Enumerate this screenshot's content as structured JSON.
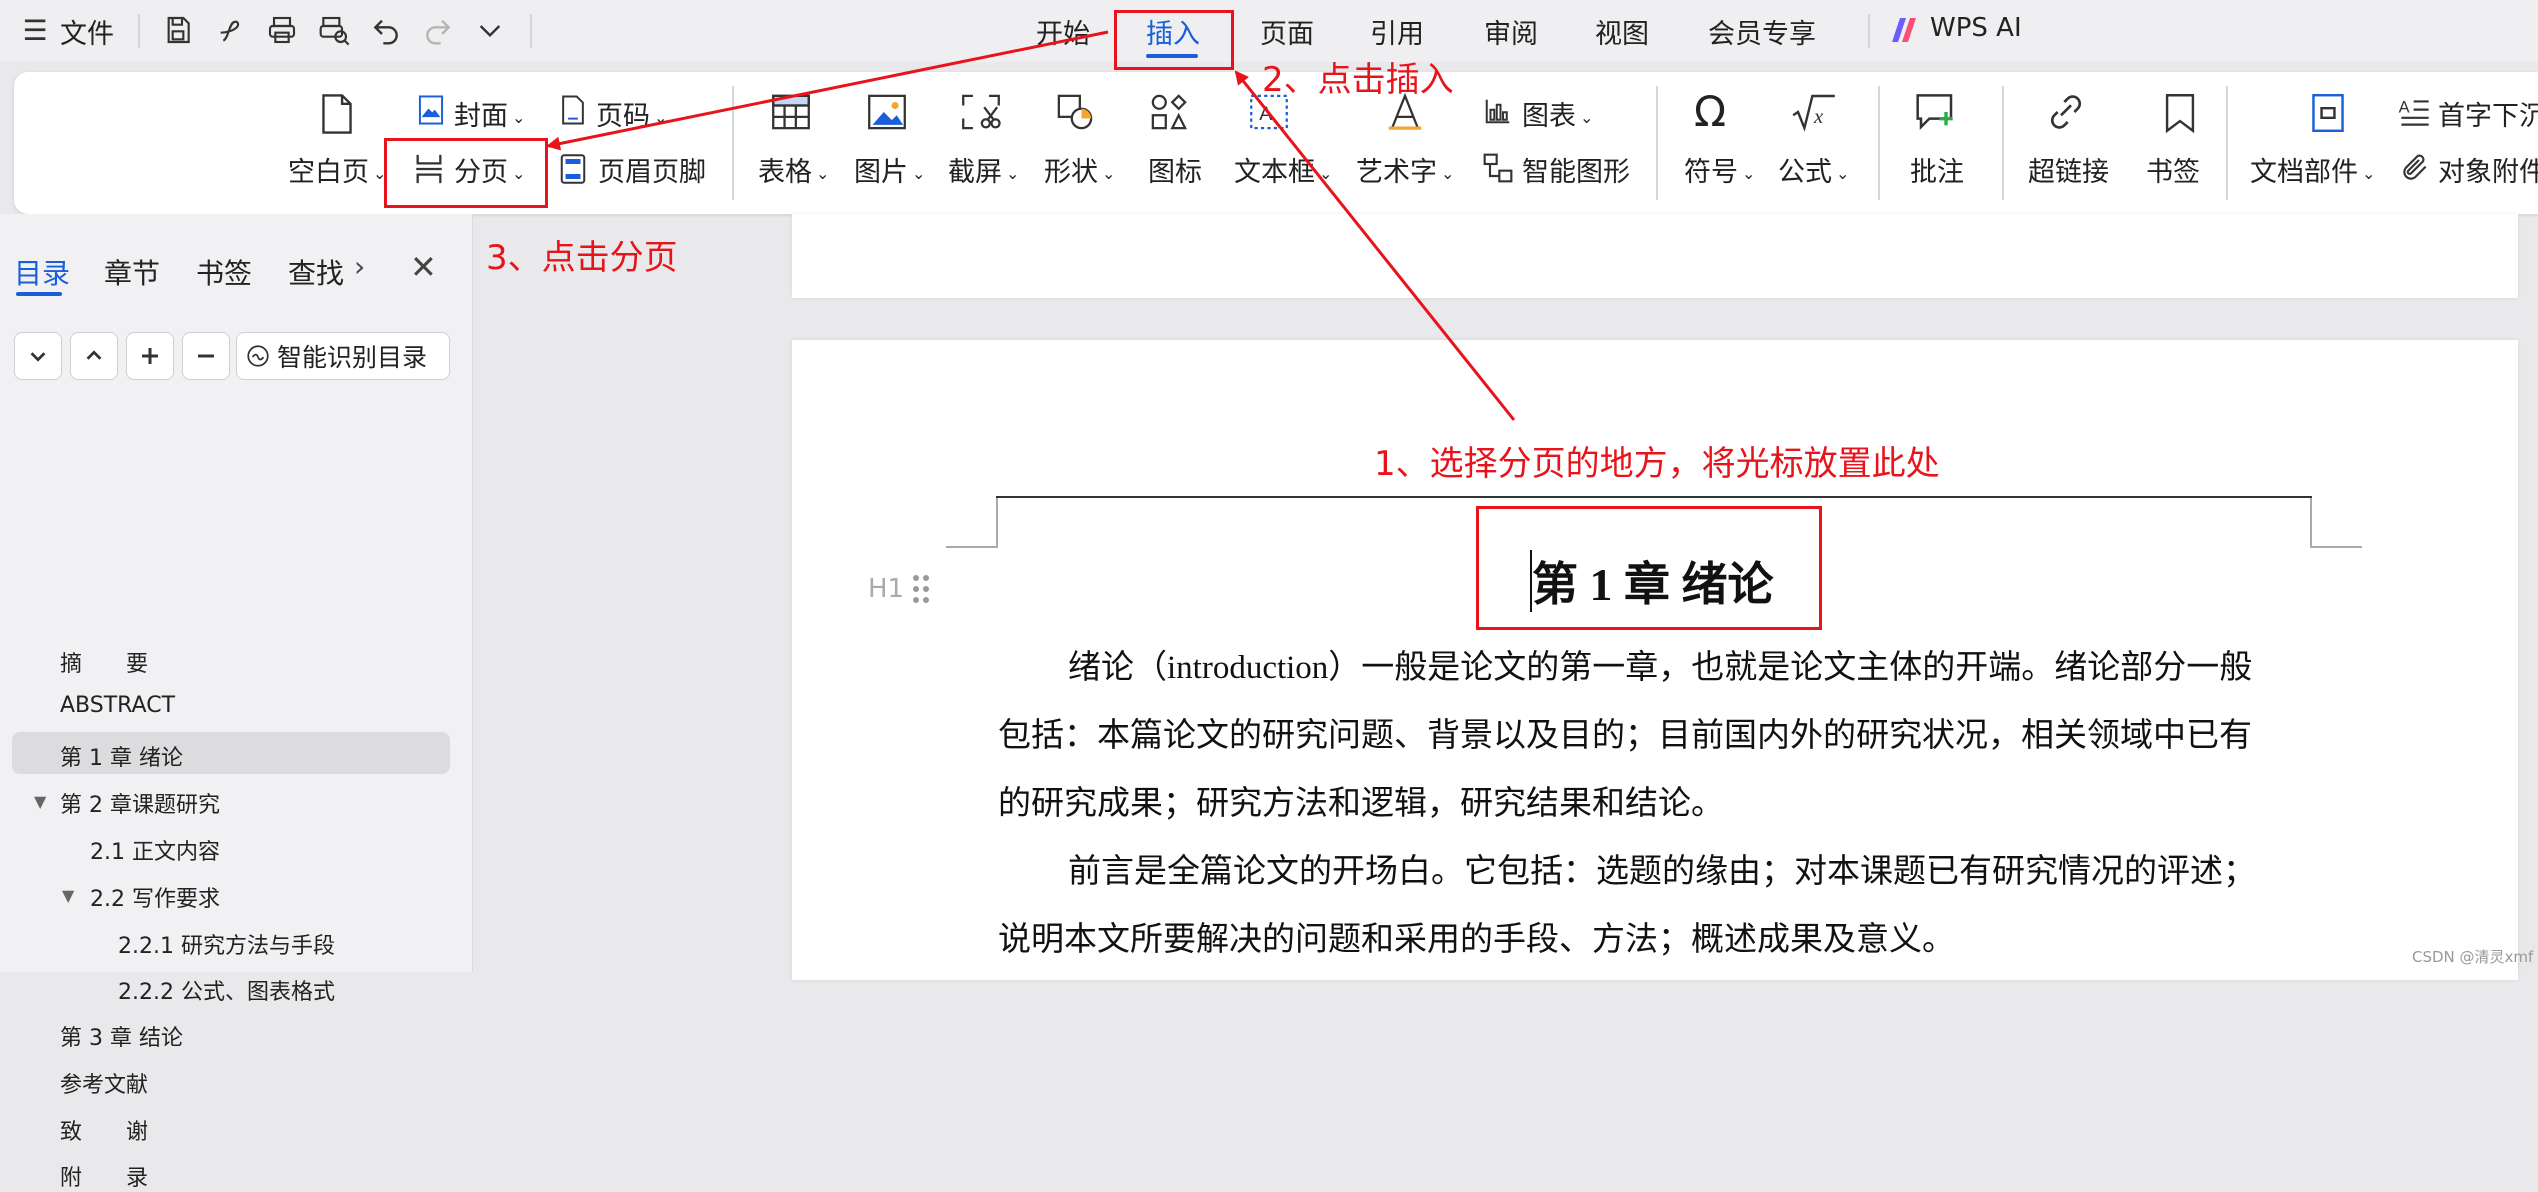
{
  "menubar": {
    "menu_label": "文件",
    "tabs": [
      "开始",
      "插入",
      "页面",
      "引用",
      "审阅",
      "视图",
      "会员专享"
    ],
    "active_tab": "插入",
    "ai_label": "WPS AI"
  },
  "ribbon": {
    "blank_page": "空白页",
    "cover": "封面",
    "page_number": "页码",
    "page_break": "分页",
    "header_footer": "页眉页脚",
    "table": "表格",
    "image": "图片",
    "screenshot": "截屏",
    "shape": "形状",
    "icon": "图标",
    "textbox": "文本框",
    "wordart": "艺术字",
    "chart": "图表",
    "smart_graphic": "智能图形",
    "symbol": "符号",
    "formula": "公式",
    "comment": "批注",
    "hyperlink": "超链接",
    "bookmark": "书签",
    "doc_parts": "文档部件",
    "drop_cap": "首字下沉",
    "attachment": "对象附件"
  },
  "sidebar": {
    "tabs": [
      "目录",
      "章节",
      "书签",
      "查找"
    ],
    "smart_toc": "智能识别目录",
    "toc": [
      {
        "label": "摘　　要",
        "level": 1
      },
      {
        "label": "ABSTRACT",
        "level": 1
      },
      {
        "label": "第 1 章  绪论",
        "level": 1,
        "selected": true
      },
      {
        "label": "第 2 章课题研究",
        "level": 1,
        "expanded": true
      },
      {
        "label": "2.1  正文内容",
        "level": 2
      },
      {
        "label": "2.2  写作要求",
        "level": 2,
        "expanded": true
      },
      {
        "label": "2.2.1  研究方法与手段",
        "level": 3
      },
      {
        "label": "2.2.2  公式、图表格式",
        "level": 3
      },
      {
        "label": "第 3 章  结论",
        "level": 1
      },
      {
        "label": "参考文献",
        "level": 1
      },
      {
        "label": "致　　谢",
        "level": 1
      },
      {
        "label": "附　　录",
        "level": 1
      }
    ]
  },
  "document": {
    "heading": "第 1 章  绪论",
    "heading_marker": "H1",
    "lines": [
      "绪论（introduction）一般是论文的第一章，也就是论文主体的开端。绪论部分一般",
      "包括：本篇论文的研究问题、背景以及目的；目前国内外的研究状况，相关领域中已有",
      "的研究成果；研究方法和逻辑，研究结果和结论。",
      "前言是全篇论文的开场白。它包括：选题的缘由；对本课题已有研究情况的评述；",
      "说明本文所要解决的问题和采用的手段、方法；概述成果及意义。"
    ]
  },
  "annotations": {
    "step1": "1、选择分页的地方，将光标放置此处",
    "step2": "2、点击插入",
    "step3": "3、点击分页"
  },
  "watermark": "CSDN @清灵xmf",
  "colors": {
    "accent": "#1a5fd9",
    "annotation": "#e8141c"
  }
}
